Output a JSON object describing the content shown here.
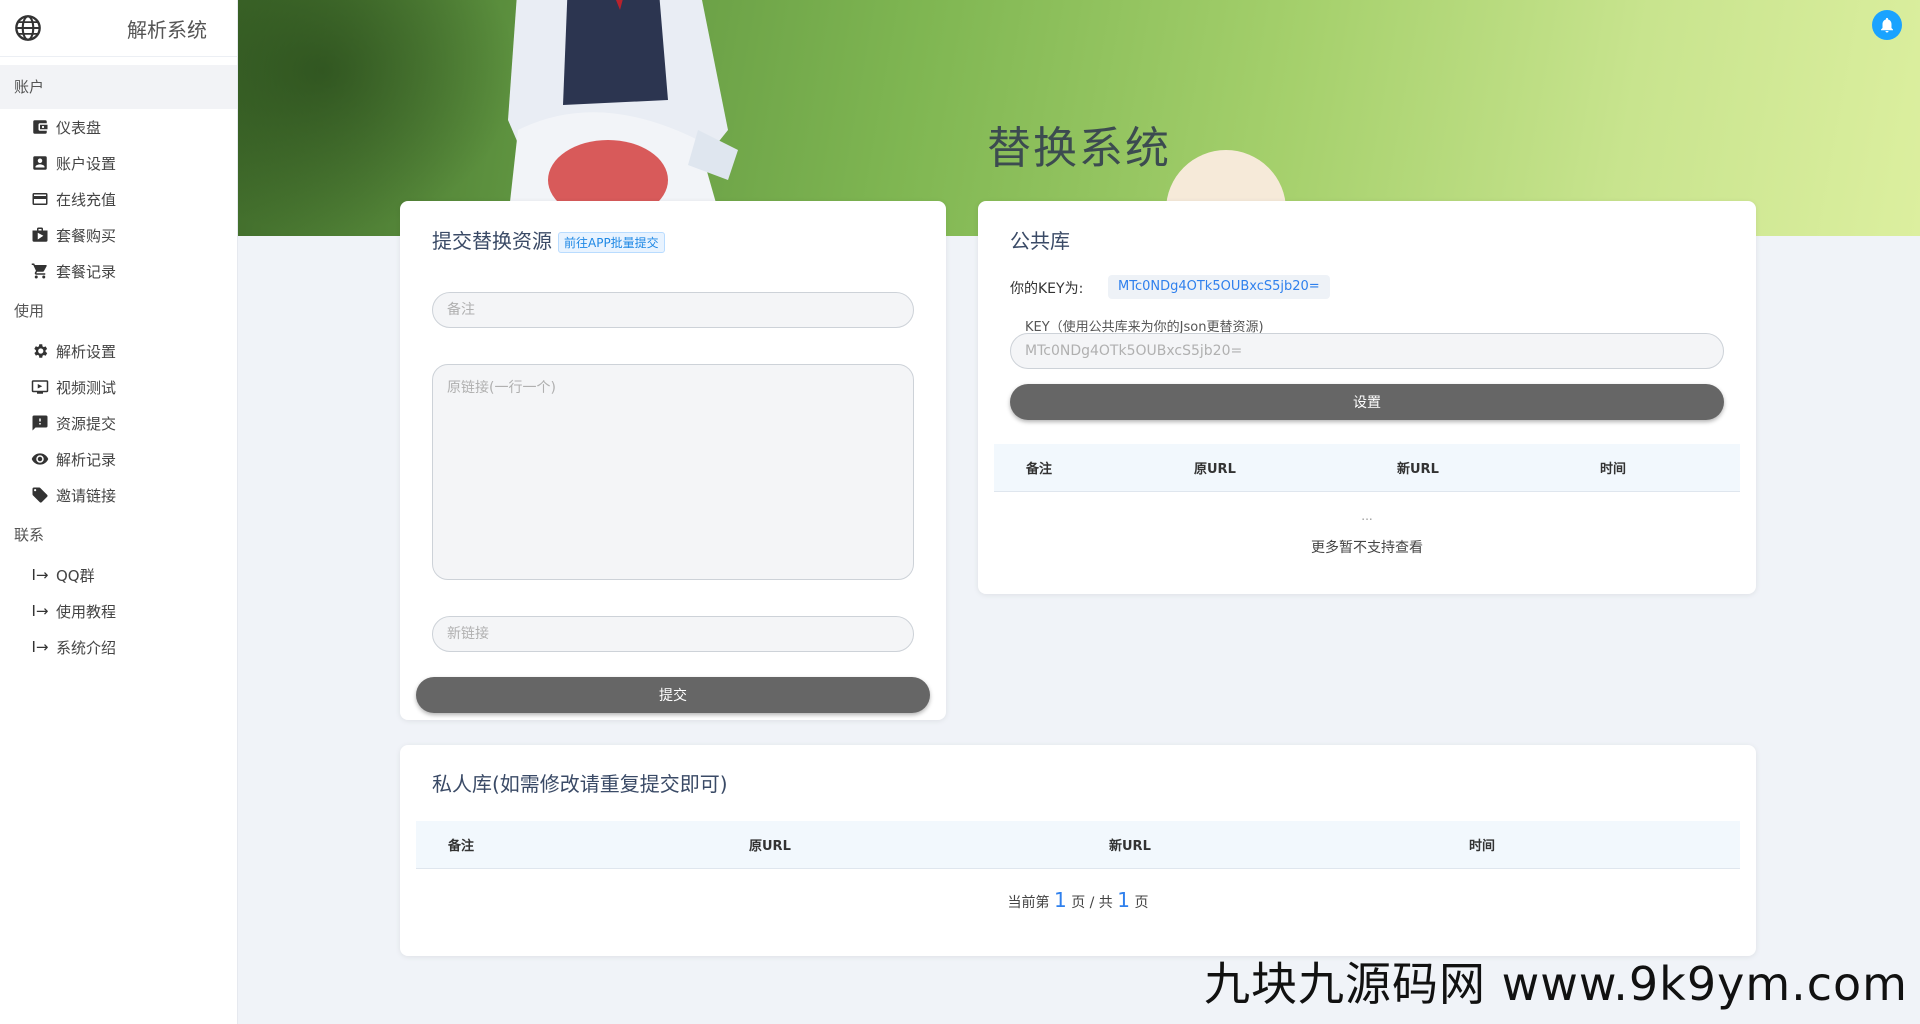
{
  "brand": {
    "title": "解析系统"
  },
  "sidebar": {
    "groups": [
      {
        "label": "账户",
        "items": [
          {
            "label": "仪表盘",
            "icon": "wallet-icon"
          },
          {
            "label": "账户设置",
            "icon": "account-box-icon"
          },
          {
            "label": "在线充值",
            "icon": "credit-card-icon"
          },
          {
            "label": "套餐购买",
            "icon": "shopping-bag-icon"
          },
          {
            "label": "套餐记录",
            "icon": "cart-icon"
          }
        ]
      },
      {
        "label": "使用",
        "items": [
          {
            "label": "解析设置",
            "icon": "gear-icon"
          },
          {
            "label": "视频测试",
            "icon": "video-play-icon"
          },
          {
            "label": "资源提交",
            "icon": "feedback-icon"
          },
          {
            "label": "解析记录",
            "icon": "eye-icon"
          },
          {
            "label": "邀请链接",
            "icon": "tag-icon"
          }
        ]
      },
      {
        "label": "联系",
        "items": [
          {
            "label": "QQ群",
            "icon": "login-arrow-icon"
          },
          {
            "label": "使用教程",
            "icon": "login-arrow-icon"
          },
          {
            "label": "系统介绍",
            "icon": "login-arrow-icon"
          }
        ]
      }
    ]
  },
  "banner": {
    "title": "替换系统"
  },
  "submit_card": {
    "title": "提交替换资源",
    "tag": "前往APP批量提交",
    "remark_placeholder": "备注",
    "original_placeholder": "原链接(一行一个)",
    "new_placeholder": "新链接",
    "submit_label": "提交"
  },
  "public_card": {
    "title": "公共库",
    "key_label": "你的KEY为:",
    "key_value": "MTc0NDg4OTk5OUBxcS5jb20=",
    "field_label": "KEY（使用公共库来为你的Json更替资源)",
    "key_placeholder": "MTc0NDg4OTk5OUBxcS5jb20=",
    "set_label": "设置",
    "columns": [
      "备注",
      "原URL",
      "新URL",
      "时间"
    ],
    "ellipsis": "...",
    "more_text": "更多暂不支持查看"
  },
  "private_card": {
    "title": "私人库(如需修改请重复提交即可)",
    "columns": [
      "备注",
      "原URL",
      "新URL",
      "时间"
    ],
    "pager_prefix": "当前第",
    "current_page": "1",
    "pager_mid": "页 / 共",
    "total_pages": "1",
    "pager_suffix": "页"
  },
  "watermark": "九块九源码网 www.9k9ym.com",
  "colors": {
    "accent": "#1e88e5",
    "button": "#666666",
    "bell": "#1aa3ff"
  }
}
